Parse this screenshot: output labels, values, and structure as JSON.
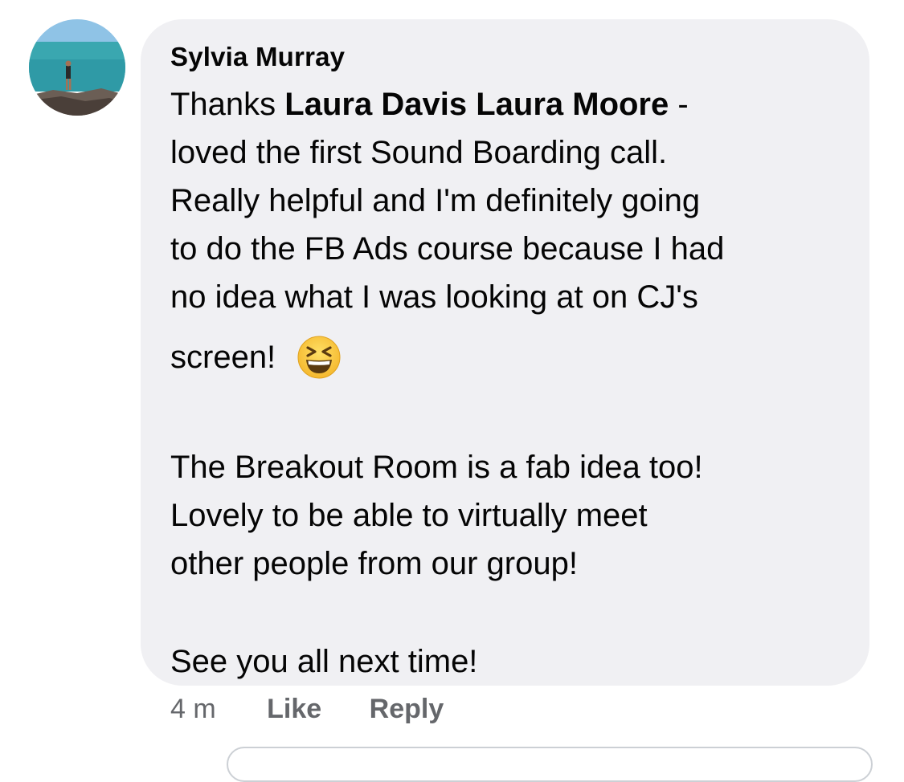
{
  "comment": {
    "author": "Sylvia Murray",
    "text_lines": [
      {
        "before": "Thanks ",
        "mention1": "Laura Davis",
        "between": " ",
        "mention2": "Laura Moore",
        "after": " -"
      },
      "loved the first Sound Boarding call.",
      "Really helpful and I'm definitely going",
      "to do the FB Ads course because I had",
      "no idea what I was looking at on CJ's",
      "screen!"
    ],
    "emoji": "grinning-squinting-face-icon",
    "paragraph2_lines": [
      "The Breakout Room is a fab idea too!",
      "Lovely to be able to virtually meet",
      "other people from our group!"
    ],
    "paragraph3_lines": [
      "See you all next time!"
    ]
  },
  "actions": {
    "timestamp": "4 m",
    "like_label": "Like",
    "reply_label": "Reply"
  },
  "colors": {
    "bubble_bg": "#f0f0f3",
    "text": "#050505",
    "meta_text": "#65676b"
  }
}
